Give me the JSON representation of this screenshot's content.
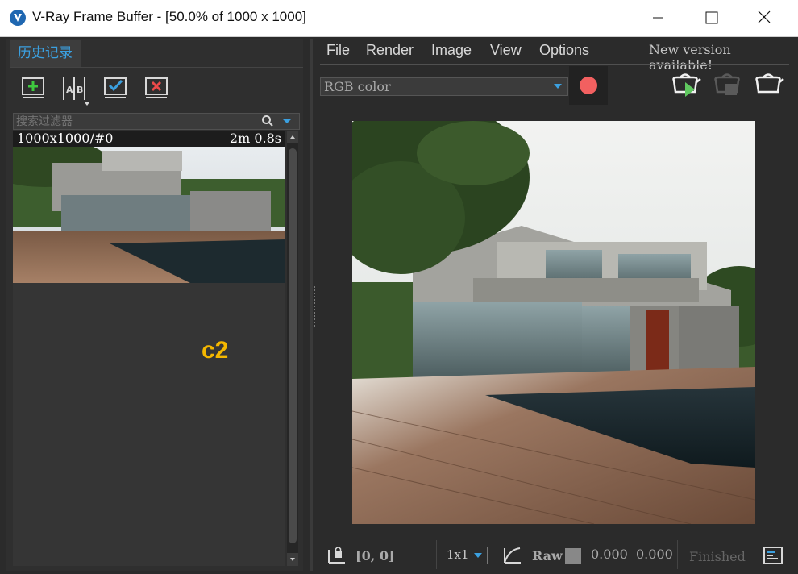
{
  "window": {
    "title": "V-Ray Frame Buffer - [50.0% of 1000 x 1000]",
    "controls": [
      "minimize-icon",
      "maximize-icon",
      "close-icon"
    ]
  },
  "history_panel": {
    "tab_label": "历史记录",
    "toolbar": [
      "save-to-history-icon",
      "ab-compare-icon",
      "load-history-icon",
      "remove-history-icon"
    ],
    "filter_placeholder": "搜索过滤器",
    "items": [
      {
        "label": "1000x1000/#0",
        "time": "2m 0.8s"
      }
    ],
    "annotation": "c2"
  },
  "menu": {
    "items": [
      "File",
      "Render",
      "Image",
      "View",
      "Options"
    ],
    "notice": "New version available!"
  },
  "toolbar": {
    "channel": "RGB color",
    "record_color": "#f26060"
  },
  "status": {
    "coords": "[0, 0]",
    "zoom": "1x1",
    "raw_label": "Raw",
    "value1": "0.000",
    "value2": "0.000",
    "state": "Finished"
  },
  "colors": {
    "accent": "#3ba0e0",
    "annotation": "#f4b700",
    "background": "#2b2b2b"
  }
}
